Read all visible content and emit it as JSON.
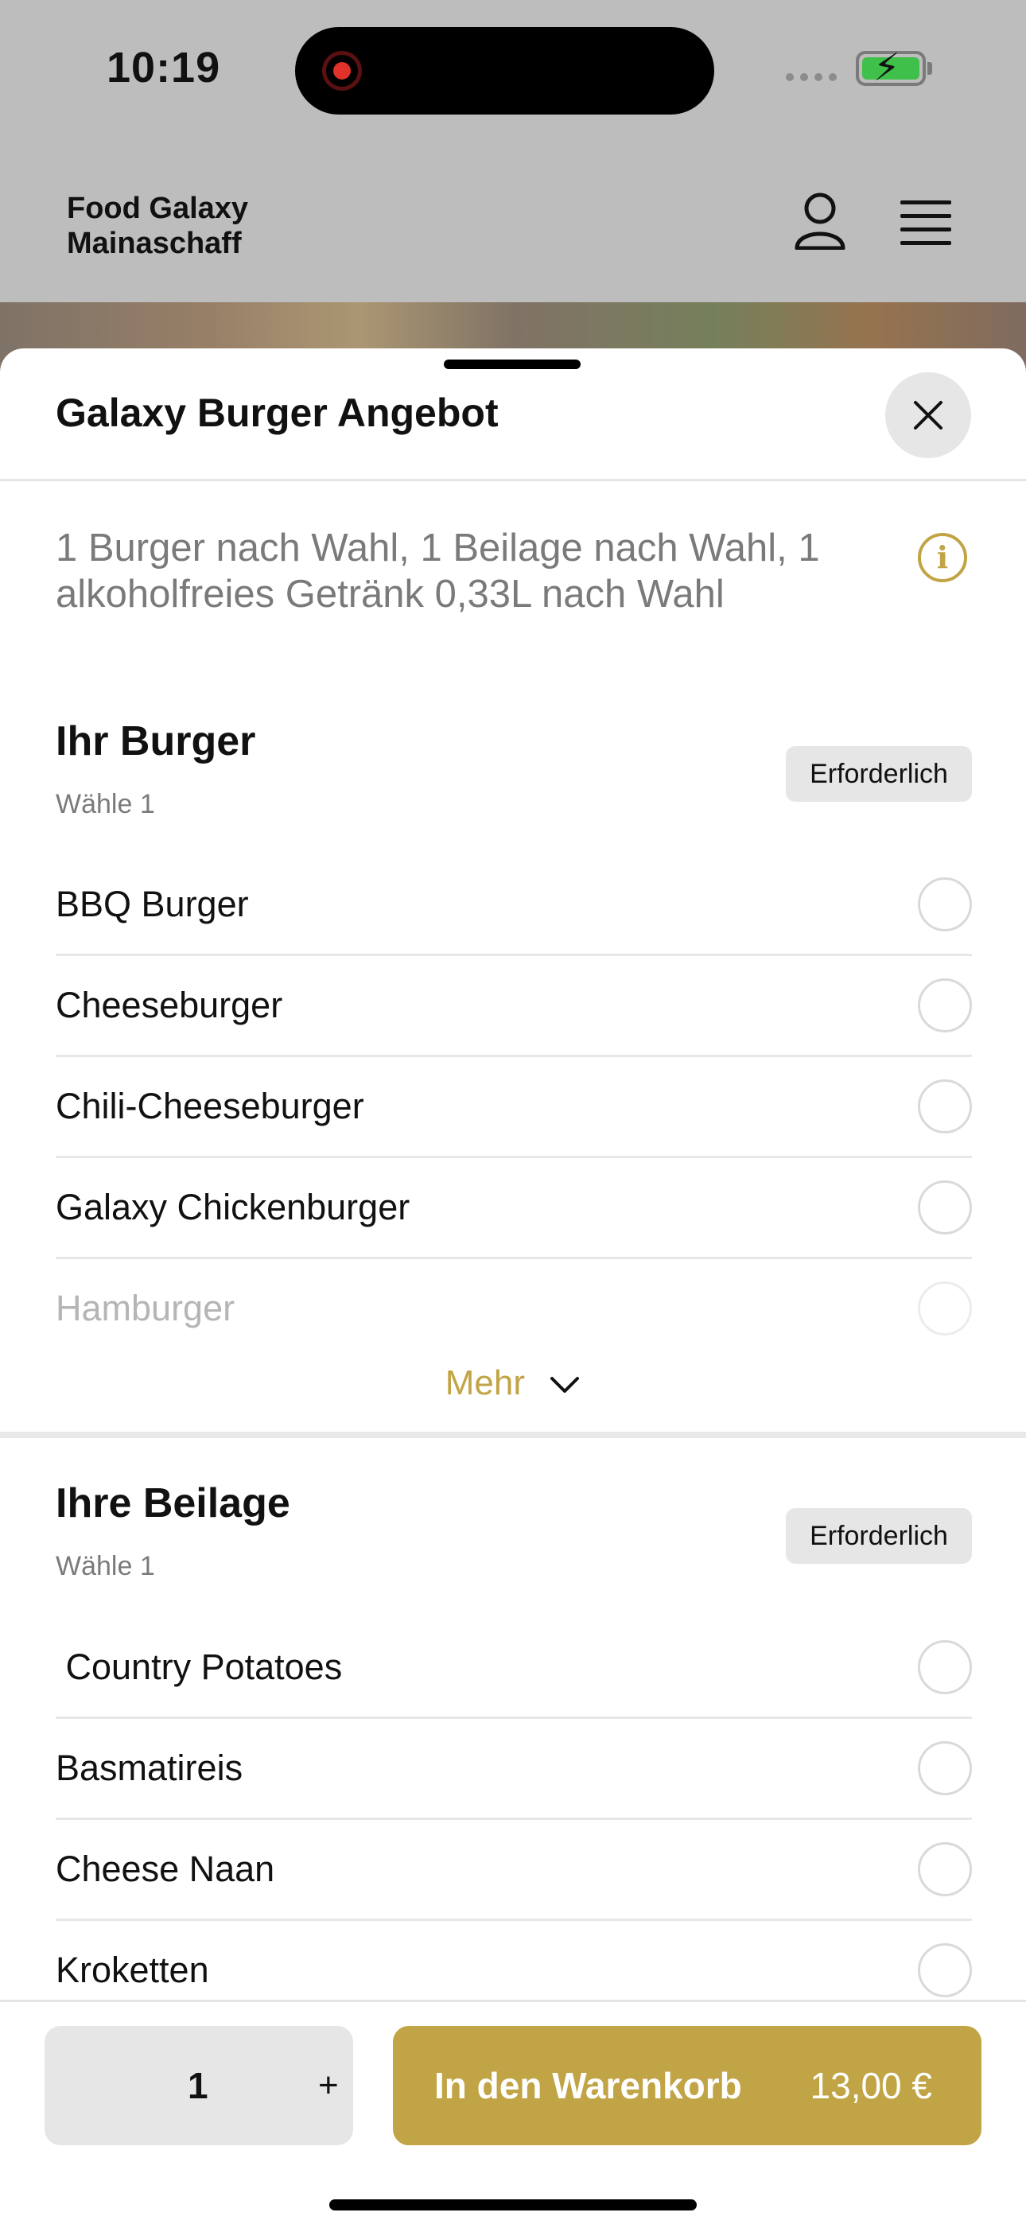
{
  "status": {
    "time": "10:19"
  },
  "header": {
    "brand_line1": "Food Galaxy",
    "brand_line2": "Mainaschaff"
  },
  "sheet": {
    "title": "Galaxy Burger Angebot",
    "description": "1 Burger nach Wahl, 1 Beilage nach Wahl, 1 alkoholfreies Getränk 0,33L nach Wahl"
  },
  "sections": [
    {
      "title": "Ihr Burger",
      "subtitle": "Wähle 1",
      "badge": "Erforderlich",
      "options": [
        "BBQ Burger",
        "Cheeseburger",
        "Chili-Cheeseburger",
        "Galaxy Chickenburger",
        "Hamburger"
      ],
      "more_label": "Mehr"
    },
    {
      "title": "Ihre Beilage",
      "subtitle": "Wähle 1",
      "badge": "Erforderlich",
      "options": [
        " Country Potatoes",
        "Basmatireis",
        "Cheese Naan",
        "Kroketten"
      ]
    }
  ],
  "footer": {
    "quantity": "1",
    "plus": "+",
    "add_to_cart_label": "In den Warenkorb",
    "price": "13,00 €"
  },
  "colors": {
    "accent": "#c1a445",
    "overlay": "#bdbdbd"
  }
}
